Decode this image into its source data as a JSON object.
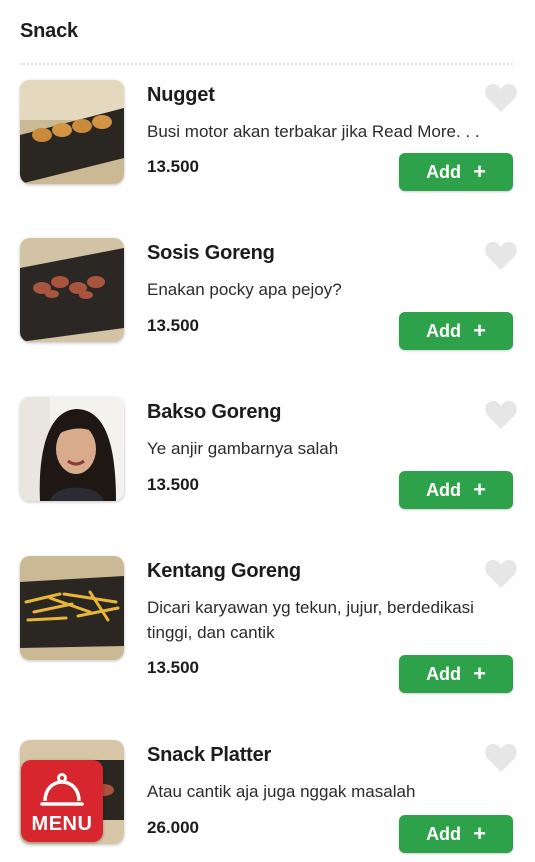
{
  "section": {
    "title": "Snack"
  },
  "add_label": "Add",
  "add_plus": "+",
  "menu_badge": {
    "label": "MENU"
  },
  "colors": {
    "accent": "#2ea24a",
    "heart": "#e6e6e6",
    "menu_badge": "#d7262e"
  },
  "items": [
    {
      "name": "Nugget",
      "description": "Busi motor akan terbakar jika Read More. . .",
      "price": "13.500",
      "image": "nugget-photo"
    },
    {
      "name": "Sosis Goreng",
      "description": "Enakan pocky apa pejoy?",
      "price": "13.500",
      "image": "sausage-photo"
    },
    {
      "name": "Bakso Goreng",
      "description": "Ye anjir gambarnya salah",
      "price": "13.500",
      "image": "portrait-photo"
    },
    {
      "name": "Kentang Goreng",
      "description": "Dicari karyawan yg tekun, jujur, berdedikasi tinggi, dan cantik",
      "price": "13.500",
      "image": "fries-photo"
    },
    {
      "name": "Snack Platter",
      "description": "Atau cantik aja juga nggak masalah",
      "price": "26.000",
      "image": "platter-photo"
    }
  ]
}
